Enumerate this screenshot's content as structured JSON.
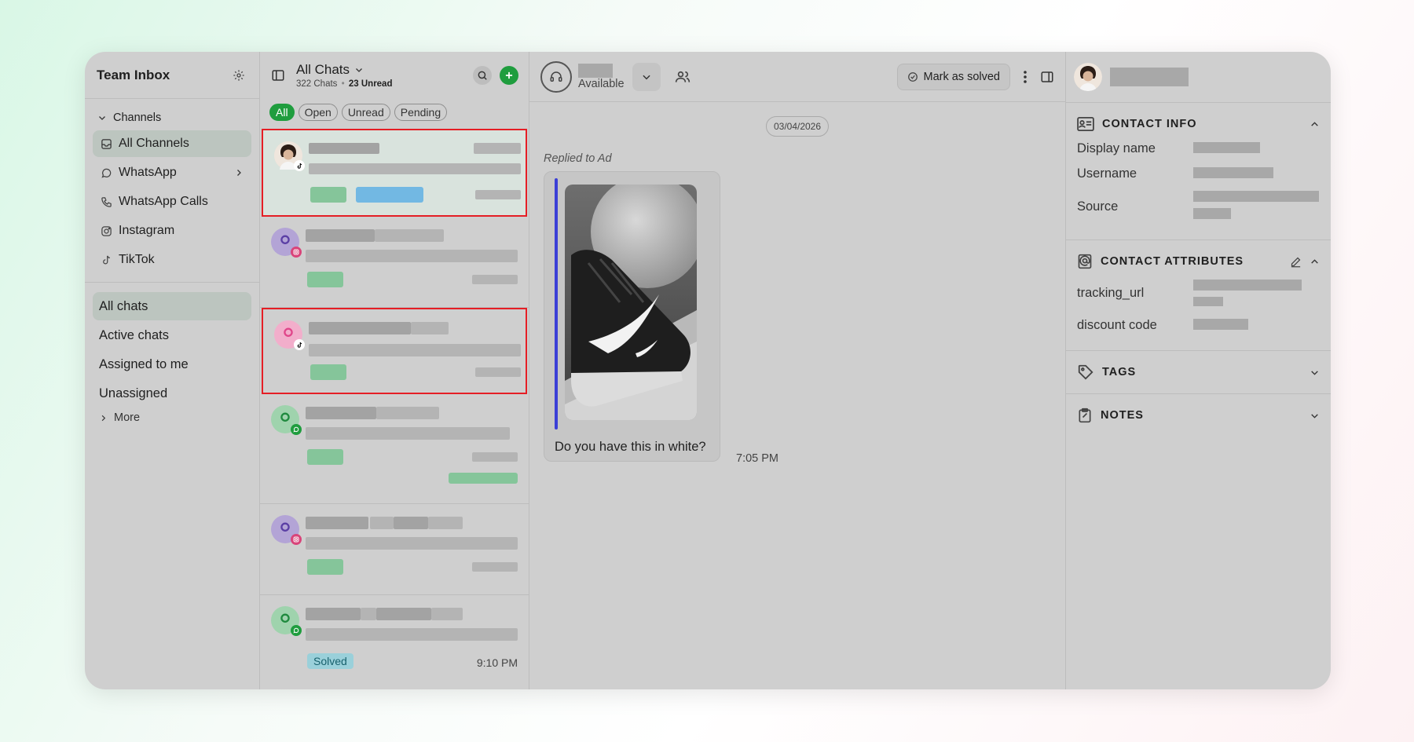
{
  "sidebar": {
    "title": "Team Inbox",
    "channels_label": "Channels",
    "channels": [
      {
        "label": "All Channels",
        "icon": "inbox-icon"
      },
      {
        "label": "WhatsApp",
        "icon": "whatsapp-icon"
      },
      {
        "label": "WhatsApp Calls",
        "icon": "phone-icon"
      },
      {
        "label": "Instagram",
        "icon": "instagram-icon"
      },
      {
        "label": "TikTok",
        "icon": "tiktok-icon"
      }
    ],
    "views": [
      {
        "label": "All chats"
      },
      {
        "label": "Active chats"
      },
      {
        "label": "Assigned to me"
      },
      {
        "label": "Unassigned"
      }
    ],
    "more_label": "More"
  },
  "chat_list": {
    "title": "All Chats",
    "count_text": "322 Chats",
    "separator": "•",
    "unread_text": "23 Unread",
    "filters": [
      {
        "label": "All"
      },
      {
        "label": "Open"
      },
      {
        "label": "Unread"
      },
      {
        "label": "Pending"
      }
    ],
    "items": [
      {
        "channel": "tiktok"
      },
      {
        "channel": "instagram"
      },
      {
        "channel": "tiktok"
      },
      {
        "channel": "whatsapp"
      },
      {
        "channel": "instagram"
      },
      {
        "channel": "whatsapp",
        "status": "Solved",
        "time": "9:10 PM"
      }
    ]
  },
  "conversation": {
    "agent_status": "Available",
    "mark_solved_label": "Mark as solved",
    "date": "03/04/2026",
    "replied_label": "Replied to Ad",
    "message_text": "Do you have this in white?",
    "message_time": "7:05 PM"
  },
  "contact": {
    "contact_info_title": "CONTACT INFO",
    "info_rows": [
      {
        "label": "Display name"
      },
      {
        "label": "Username"
      },
      {
        "label": "Source"
      }
    ],
    "attributes_title": "CONTACT ATTRIBUTES",
    "attribute_rows": [
      {
        "label": "tracking_url"
      },
      {
        "label": "discount code"
      }
    ],
    "tags_title": "TAGS",
    "notes_title": "NOTES"
  },
  "colors": {
    "accent_green": "#1f9d3e",
    "highlight_red": "#e51e25",
    "ad_bar_blue": "#3b3fd6",
    "solved_badge": "#9ad0da"
  }
}
